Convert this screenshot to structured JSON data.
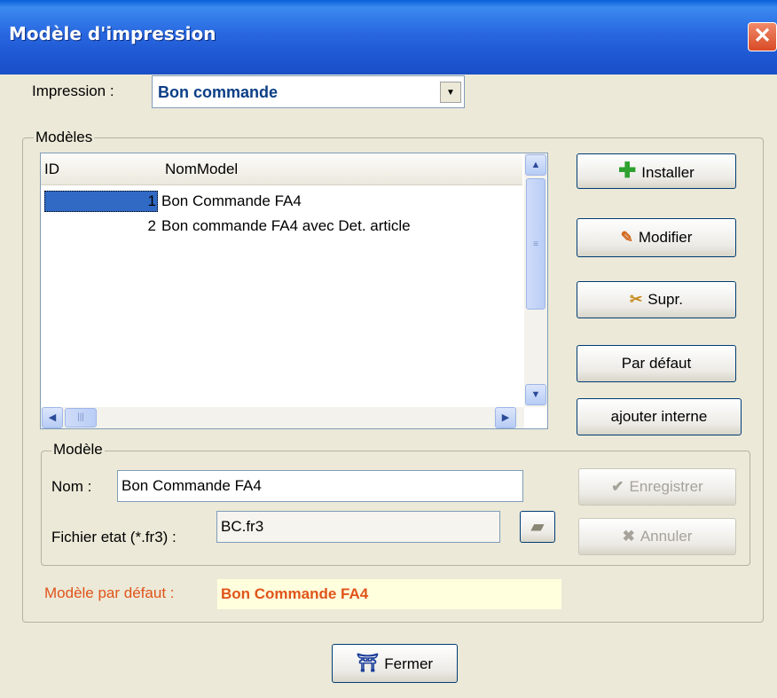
{
  "window": {
    "title": "Modèle d'impression",
    "close_glyph": "✕"
  },
  "impression": {
    "label": "Impression :",
    "selected": "Bon commande"
  },
  "models_group": {
    "label": "Modèles"
  },
  "list": {
    "columns": [
      "ID",
      "NomModel"
    ],
    "rows": [
      {
        "id": "1",
        "name": "Bon Commande FA4",
        "selected": true
      },
      {
        "id": "2",
        "name": "Bon commande FA4 avec Det. article",
        "selected": false
      }
    ]
  },
  "buttons": {
    "install": "Installer",
    "modify": "Modifier",
    "delete": "Supr.",
    "default": "Par défaut",
    "add_internal": "ajouter interne",
    "save": "Enregistrer",
    "cancel": "Annuler",
    "close": "Fermer"
  },
  "model_group": {
    "label": "Modèle",
    "name_label": "Nom :",
    "name_value": "Bon Commande FA4",
    "file_label": "Fichier etat (*.fr3) :",
    "file_value": "BC.fr3"
  },
  "default_model": {
    "label": "Modèle par défaut :",
    "value": "Bon Commande FA4"
  },
  "icons": {
    "install": "plus-icon",
    "modify": "pencil-icon",
    "delete": "scissors-icon",
    "browse": "folder-icon",
    "save": "check-icon",
    "cancel": "x-icon",
    "close": "exit-door-icon"
  },
  "colors": {
    "title_bar": "#2867e0",
    "selection": "#316ac5",
    "default_value": "#e0541a",
    "default_bg": "#ffffdd",
    "combo_text": "#0b3e86"
  }
}
